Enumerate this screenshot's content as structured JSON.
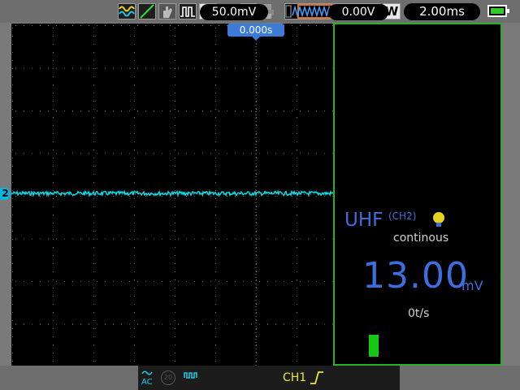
{
  "toolbar": {
    "icons": [
      "waveform-icon",
      "cursor-icon",
      "hand-icon",
      "pulse-icon",
      "auto-icon",
      "key-icon",
      "save-icon",
      "print-icon"
    ],
    "auto_label": "A",
    "memory_icon": "memory-depth-icon",
    "acquire_label": "W",
    "timebase": "2.00ms"
  },
  "screen": {
    "channel_marker": "2",
    "trigger_position": "0.000s",
    "trace_color": "#00e0f0"
  },
  "panel": {
    "title": "UHF",
    "channel": "(CH2)",
    "mode": "continous",
    "value": "13.00",
    "unit": "mV",
    "rate": "0t/s",
    "level_fraction": 0.1,
    "accent": "#3c6ee0",
    "border": "#28b028"
  },
  "bottom": {
    "coupling": "AC",
    "bandwidth": "20",
    "volts_div": "50.0mV",
    "trigger_source": "CH1",
    "trigger_level": "0.00V"
  }
}
